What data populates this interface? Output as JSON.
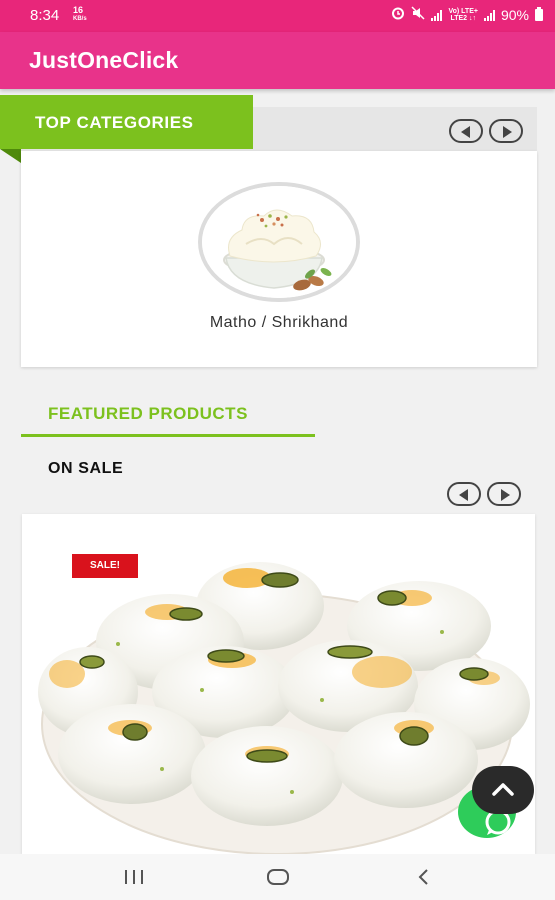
{
  "status_bar": {
    "time": "8:34",
    "notification_top": "16",
    "notification_bottom": "KB/s",
    "lte_top": "Vo) LTE+",
    "lte_bottom": "LTE2 ↓↑",
    "battery": "90%"
  },
  "app_bar": {
    "title": "JustOneClick"
  },
  "top_categories": {
    "title": "TOP CATEGORIES",
    "items": [
      {
        "label": "Matho / Shrikhand",
        "icon": "shrikhand-bowl-image"
      }
    ]
  },
  "featured": {
    "title": "FEATURED PRODUCTS",
    "subtitle": "ON SALE",
    "products": [
      {
        "badge": "SALE!",
        "icon": "rasmalai-sweets-image"
      }
    ]
  },
  "colors": {
    "status_bar": "#e8267a",
    "app_bar": "#e8338a",
    "accent_green": "#7cc11e",
    "sale_red": "#d9121c",
    "whatsapp_green": "#2ecc5a"
  }
}
